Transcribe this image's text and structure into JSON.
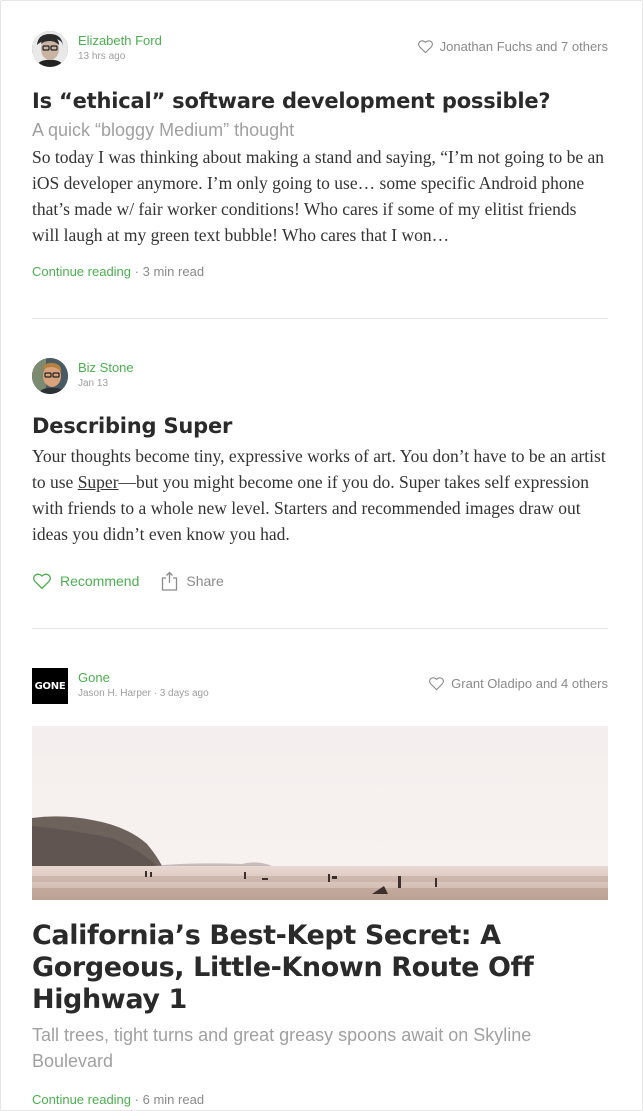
{
  "posts": [
    {
      "author": "Elizabeth Ford",
      "meta": "13 hrs ago",
      "likes": "Jonathan Fuchs and 7 others",
      "title": "Is “ethical” software development possible?",
      "subtitle": "A quick “bloggy Medium” thought",
      "body": "So today I was thinking about making a stand and saying, “I’m not going to be an iOS developer anymore. I’m only going to use… some specific Android phone that’s made w/ fair worker conditions! Who cares if some of my elitist friends will laugh at my green text bubble! Who cares that I won…",
      "continue": "Continue reading",
      "sep": "·",
      "read_time": "3 min read"
    },
    {
      "author": "Biz Stone",
      "meta": "Jan 13",
      "title": "Describing Super",
      "body_before": "Your thoughts become tiny, expressive works of art. You don’t have to be an artist to use ",
      "body_link": "Super",
      "body_after": "—but you might become one if you do. Super takes self expression with friends to a whole new level. Starters and recommended images draw out ideas you didn’t even know you had.",
      "recommend": "Recommend",
      "share": "Share"
    },
    {
      "publication": "Gone",
      "logo_text": "GONE",
      "author": "Jason H. Harper",
      "sep": "·",
      "meta": "3 days ago",
      "likes": "Grant Oladipo and 4 others",
      "title": "California’s Best-Kept Secret: A Gorgeous, Little-Known Route Off Highway 1",
      "subtitle": "Tall trees, tight turns and great greasy spoons await on Skyline Boulevard",
      "continue": "Continue reading",
      "read_time": "6 min read"
    }
  ],
  "colors": {
    "accent": "#4caf50",
    "muted": "#8a8a8a",
    "title": "#2a2a2a"
  },
  "icons": [
    "heart-icon",
    "share-icon"
  ]
}
